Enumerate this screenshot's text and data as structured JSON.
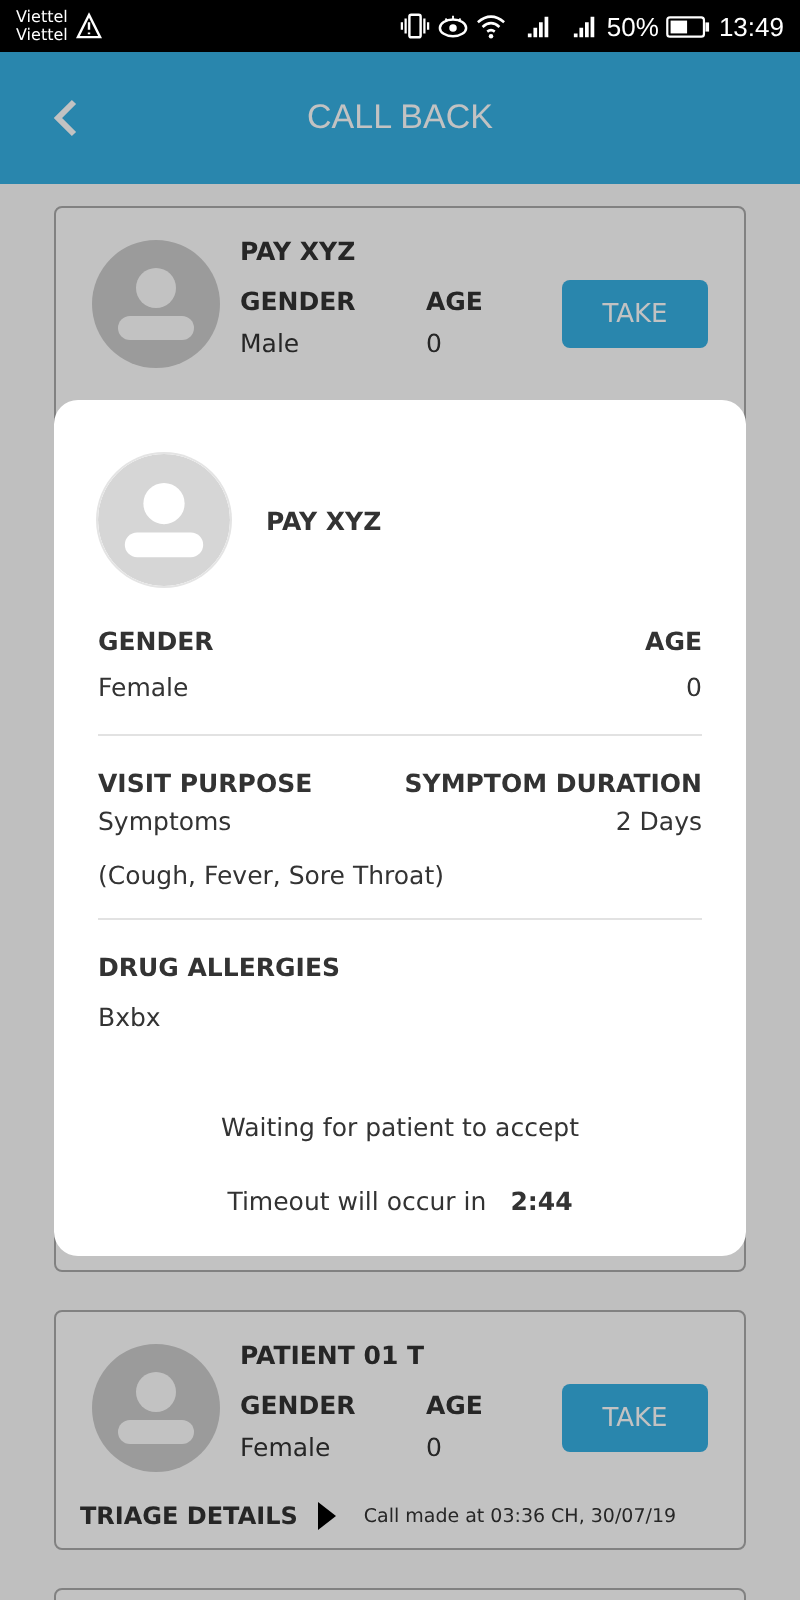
{
  "status_bar": {
    "carriers": [
      "Viettel",
      "Viettel"
    ],
    "battery": "50%",
    "time": "13:49"
  },
  "header": {
    "title": "CALL BACK"
  },
  "cards": [
    {
      "kind": "full",
      "name": "PAY XYZ",
      "gender_label": "GENDER",
      "gender": "Male",
      "age_label": "AGE",
      "age": "0",
      "button": "TAKE"
    },
    {
      "kind": "hidden"
    },
    {
      "kind": "full",
      "name": "PATIENT 01 T",
      "gender_label": "GENDER",
      "gender": "Female",
      "age_label": "AGE",
      "age": "0",
      "button": "TAKE",
      "triage": "TRIAGE DETAILS",
      "call_time": "Call made at 03:36 CH, 30/07/19"
    },
    {
      "kind": "edge"
    }
  ],
  "dialog": {
    "name": "PAY XYZ",
    "gender_label": "GENDER",
    "gender": "Female",
    "age_label": "AGE",
    "age": "0",
    "visit_label": "VISIT PURPOSE",
    "visit": "Symptoms",
    "duration_label": "SYMPTOM DURATION",
    "duration": "2 Days",
    "symptoms": "(Cough, Fever, Sore Throat)",
    "allergies_label": "DRUG ALLERGIES",
    "allergies": "Bxbx",
    "waiting": "Waiting for patient to accept",
    "timeout_label": "Timeout will occur in",
    "timeout": "2:44"
  }
}
